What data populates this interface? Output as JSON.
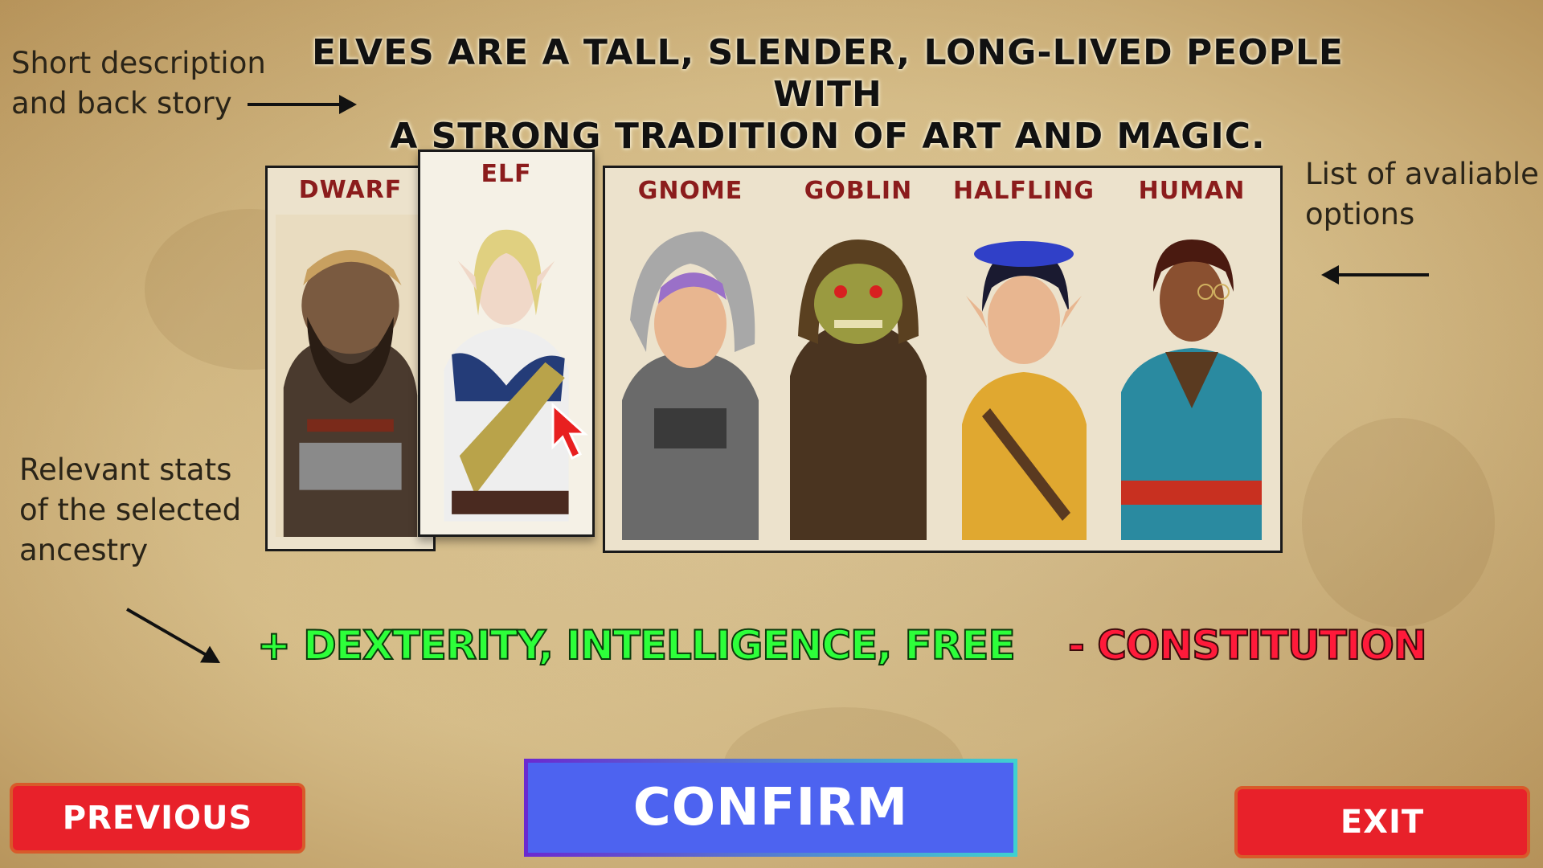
{
  "annotations": {
    "description": [
      "Short description",
      "and back story"
    ],
    "options": [
      "List of avaliable",
      "options"
    ],
    "stats": [
      "Relevant stats",
      "of the selected",
      "ancestry"
    ]
  },
  "headline": [
    "Elves are a tall, slender, long-lived people with",
    "a strong tradition of art and magic."
  ],
  "ancestries": [
    {
      "label": "DWARF",
      "selected": false
    },
    {
      "label": "ELF",
      "selected": true
    },
    {
      "label": "GNOME",
      "selected": false
    },
    {
      "label": "GOBLIN",
      "selected": false
    },
    {
      "label": "HALFLING",
      "selected": false
    },
    {
      "label": "HUMAN",
      "selected": false
    }
  ],
  "stats": {
    "bonuses": "+ DEXTERITY, INTELLIGENCE, FREE",
    "penalties": "- CONSTITUTION"
  },
  "buttons": {
    "previous": "PREVIOUS",
    "confirm": "CONFIRM",
    "exit": "EXIT"
  },
  "colors": {
    "bonus": "#2dff3a",
    "penalty": "#ff1a3a",
    "label": "#8b1c1c",
    "confirm": "#4d63f0",
    "nav": "#e8212a"
  }
}
